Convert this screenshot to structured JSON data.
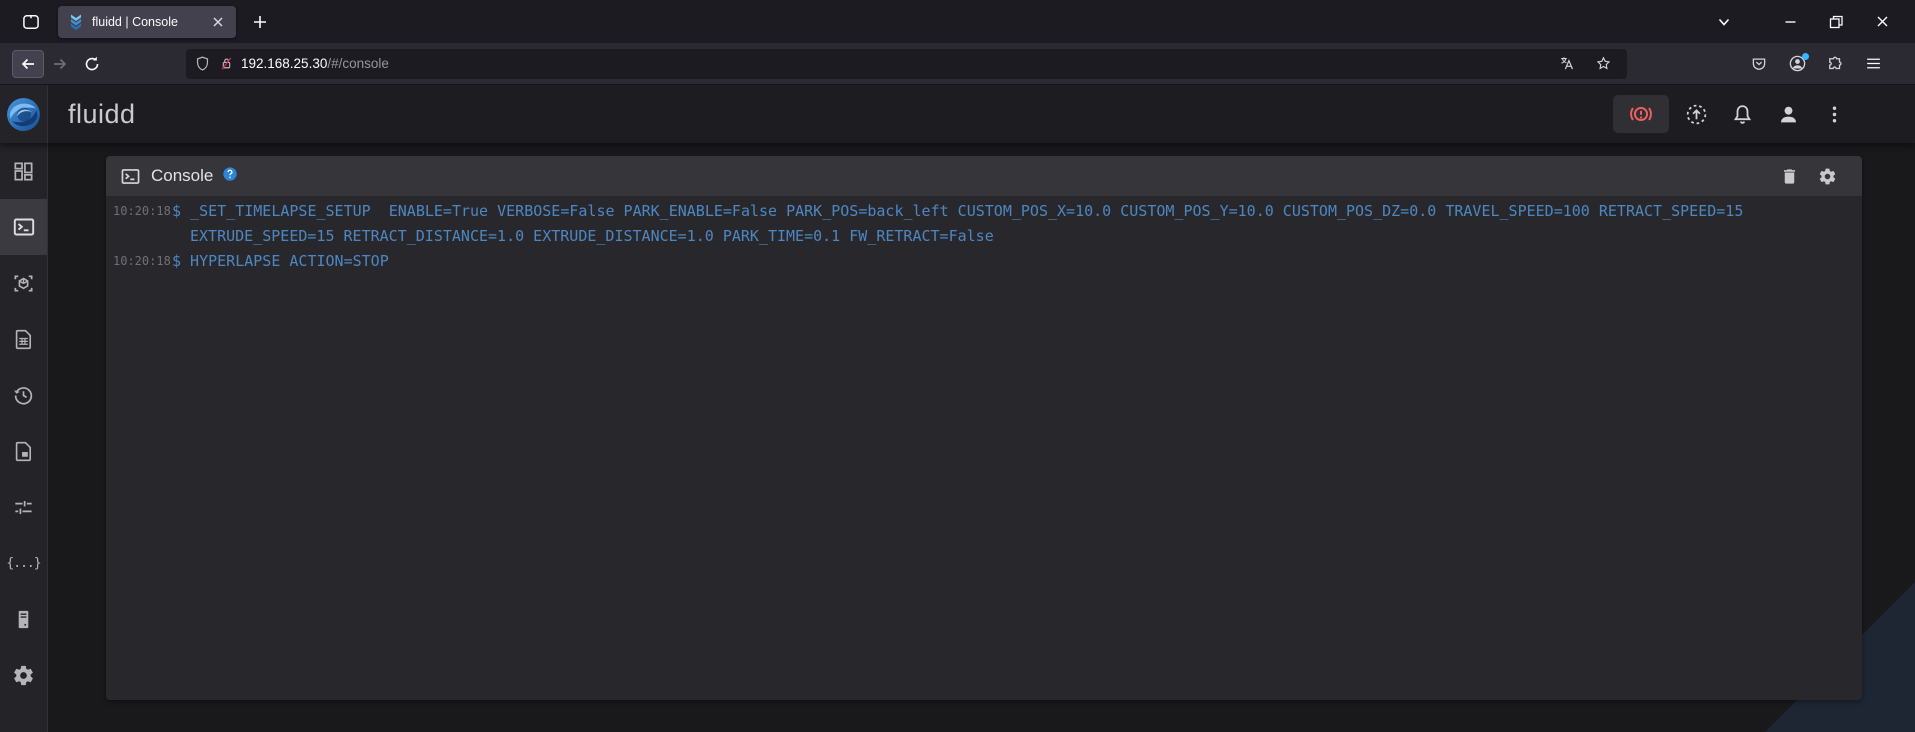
{
  "browser": {
    "tab": {
      "title": "fluidd | Console",
      "favicon": "fluidd-logo"
    },
    "window_controls": [
      "list-all-tabs",
      "minimize",
      "maximize",
      "close"
    ],
    "toolbar": {
      "url_host": "192.168.25.30",
      "url_path": "/#/console",
      "left_icons": [
        "back",
        "forward",
        "reload"
      ],
      "urlbar_icons": [
        "tracking-shield",
        "insecure-lock",
        "translate",
        "bookmark-star"
      ],
      "right_icons": [
        "pocket",
        "account",
        "extensions",
        "menu"
      ]
    }
  },
  "app": {
    "title": "fluidd",
    "header_icons": [
      "printer-error-alert",
      "update-check",
      "notifications-bell",
      "account",
      "overflow-menu"
    ],
    "nav_icons": [
      "dashboard",
      "console",
      "gcode-preview",
      "jobs",
      "history",
      "timelapse",
      "tune",
      "configure",
      "system",
      "settings"
    ],
    "console": {
      "title": "Console",
      "header_icons": [
        "help",
        "clear-console",
        "console-settings"
      ],
      "entries": [
        {
          "time": "10:20:18",
          "message": "$ _SET_TIMELAPSE_SETUP  ENABLE=True VERBOSE=False PARK_ENABLE=False PARK_POS=back_left CUSTOM_POS_X=10.0 CUSTOM_POS_Y=10.0 CUSTOM_POS_DZ=0.0 TRAVEL_SPEED=100 RETRACT_SPEED=15 EXTRUDE_SPEED=15 RETRACT_DISTANCE=1.0 EXTRUDE_DISTANCE=1.0 PARK_TIME=0.1 FW_RETRACT=False"
        },
        {
          "time": "10:20:18",
          "message": "$ HYPERLAPSE ACTION=STOP"
        }
      ]
    },
    "colors": {
      "error": "#f25f5f",
      "help": "#2d84d8",
      "command_text": "#4d87c2",
      "timestamp": "#6f6f78"
    }
  }
}
